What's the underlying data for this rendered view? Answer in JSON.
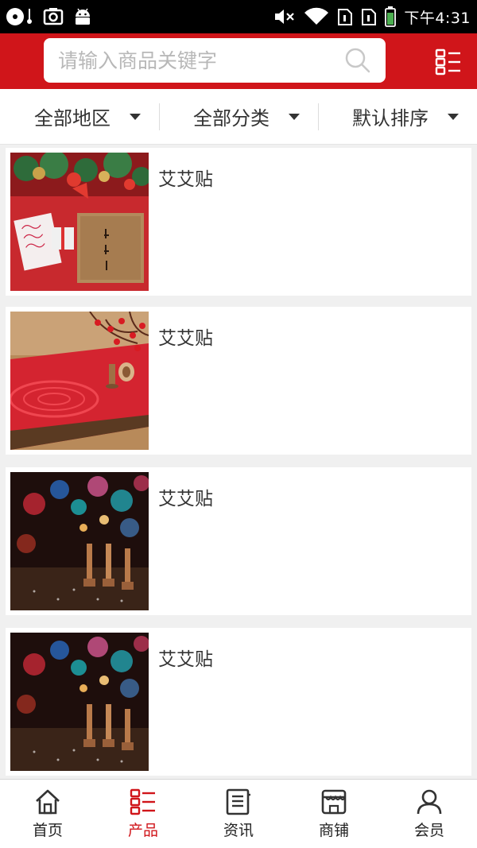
{
  "status_bar": {
    "time": "下午4:31",
    "icons": [
      "media-icon",
      "screenshot-icon",
      "android-icon",
      "mute-icon",
      "wifi-icon",
      "sim1-icon",
      "sim2-icon",
      "battery-icon"
    ]
  },
  "search": {
    "placeholder": "请输入商品关键字",
    "value": ""
  },
  "filters": [
    {
      "label": "全部地区"
    },
    {
      "label": "全部分类"
    },
    {
      "label": "默认排序"
    }
  ],
  "products": [
    {
      "title": "艾艾贴",
      "image": "christmas-gift-box"
    },
    {
      "title": "艾艾贴",
      "image": "red-papercut-table"
    },
    {
      "title": "艾艾贴",
      "image": "bokeh-moxa-sticks"
    },
    {
      "title": "艾艾贴",
      "image": "bokeh-moxa-sticks"
    }
  ],
  "tabs": [
    {
      "label": "首页",
      "icon": "home-icon",
      "active": false
    },
    {
      "label": "产品",
      "icon": "product-list-icon",
      "active": true
    },
    {
      "label": "资讯",
      "icon": "news-icon",
      "active": false
    },
    {
      "label": "商铺",
      "icon": "shop-icon",
      "active": false
    },
    {
      "label": "会员",
      "icon": "member-icon",
      "active": false
    }
  ],
  "colors": {
    "brand_red": "#d0151a",
    "background": "#f0f0f0",
    "text": "#333333",
    "placeholder": "#b8b8b8"
  }
}
